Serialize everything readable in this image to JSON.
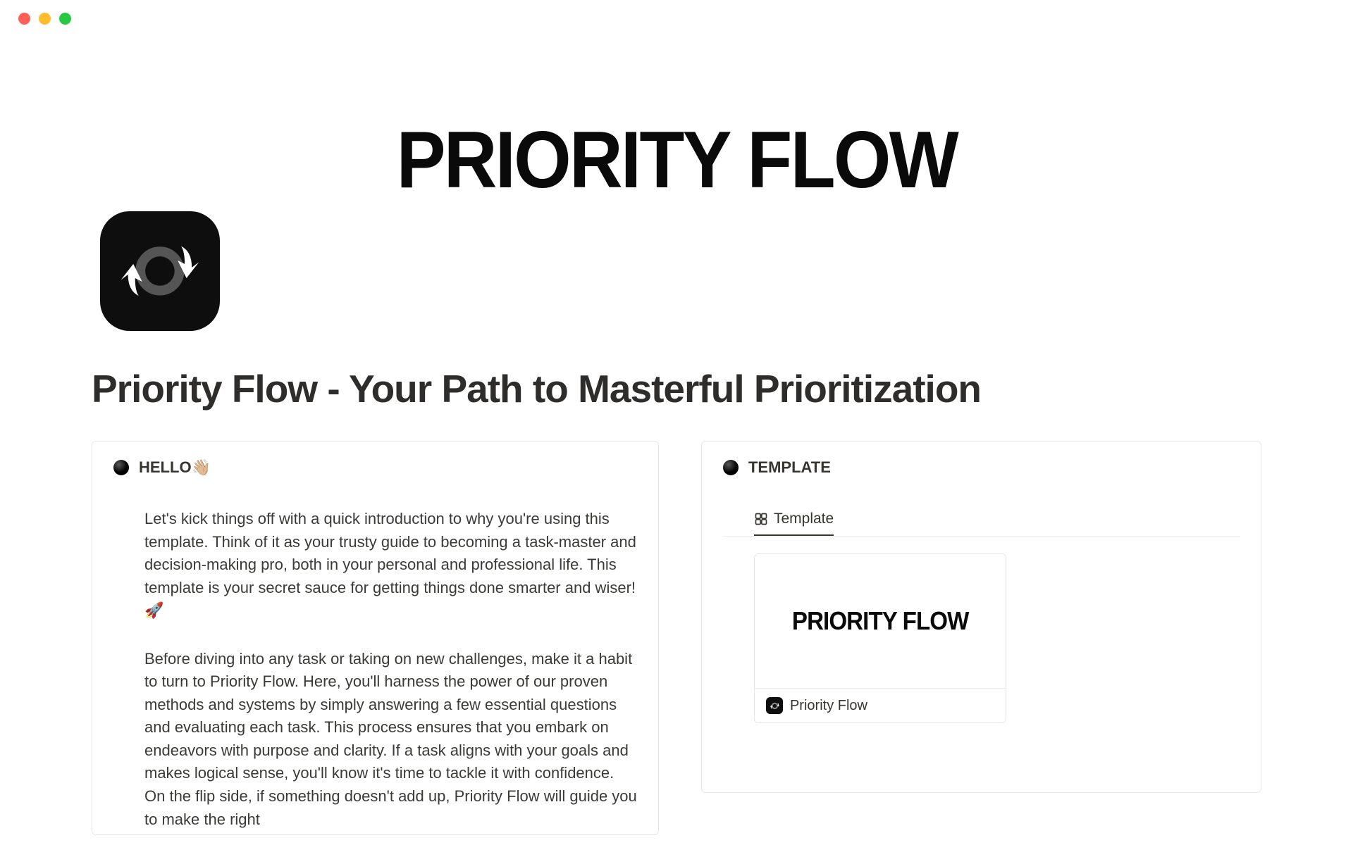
{
  "hero": {
    "title": "PRIORITY FLOW"
  },
  "page": {
    "title": "Priority Flow - Your Path to Masterful Prioritization"
  },
  "hello_card": {
    "heading": "HELLO👋🏼",
    "para1": "Let's kick things off with a quick introduction to why you're using this template. Think of it as your trusty guide to becoming a task-master and decision-making pro, both in your personal and professional life. This template is your secret sauce for getting things done smarter and wiser! 🚀",
    "para2": "Before diving into any task or taking on new challenges, make it a habit to turn to Priority Flow. Here, you'll harness the power of our proven methods and systems by simply answering a few essential questions and evaluating each task. This process ensures that you embark on endeavors with purpose and clarity. If a task aligns with your goals and makes logical sense, you'll know it's time to tackle it with confidence. On the flip side, if something doesn't add up, Priority Flow will guide you to make the right"
  },
  "template_card": {
    "heading": "TEMPLATE",
    "tab_label": "Template",
    "preview_title": "PRIORITY FLOW",
    "preview_label": "Priority Flow"
  }
}
